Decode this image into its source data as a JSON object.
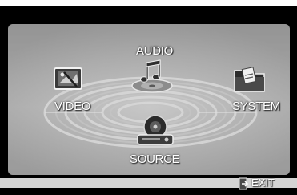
{
  "menu": {
    "audio_label": "AUDIO",
    "video_label": "VIDEO",
    "system_label": "SYSTEM",
    "source_label": "SOURCE"
  },
  "footer": {
    "exit_label": "EXIT"
  },
  "icons": {
    "audio": "music-notes-disc-icon",
    "video": "video-monitor-icon",
    "system": "folder-settings-icon",
    "source": "disc-player-icon",
    "exit": "exit-icon"
  },
  "colors": {
    "background": "#000000",
    "panel": "#a9a9a9",
    "label": "#ffffff",
    "bottom_bar": "#d4d4d4"
  }
}
